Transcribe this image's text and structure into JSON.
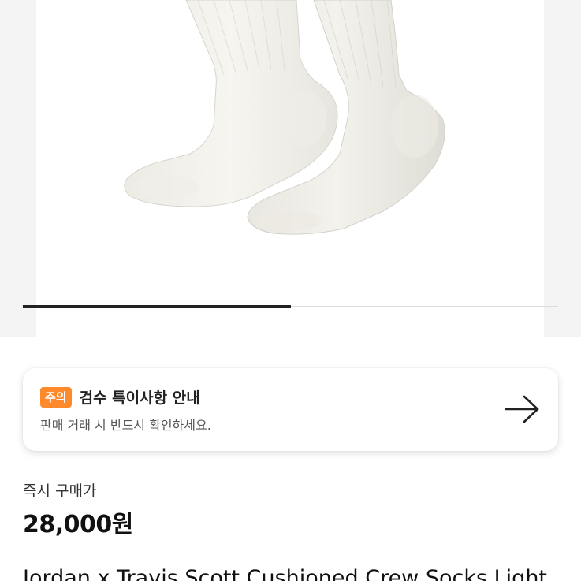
{
  "product_image": {
    "alt": "Jordan x Travis Scott Cushioned Crew Socks",
    "carousel_progress": 0.5
  },
  "notice": {
    "badge": "주의",
    "title": "검수 특이사항 안내",
    "description": "판매 거래 시 반드시 확인하세요.",
    "arrow_icon": "arrow-right-icon",
    "badge_color": "#ff8a2b"
  },
  "price": {
    "label": "즉시 구매가",
    "value": "28,000원"
  },
  "product": {
    "name": "Jordan x Travis Scott Cushioned Crew Socks Light"
  }
}
